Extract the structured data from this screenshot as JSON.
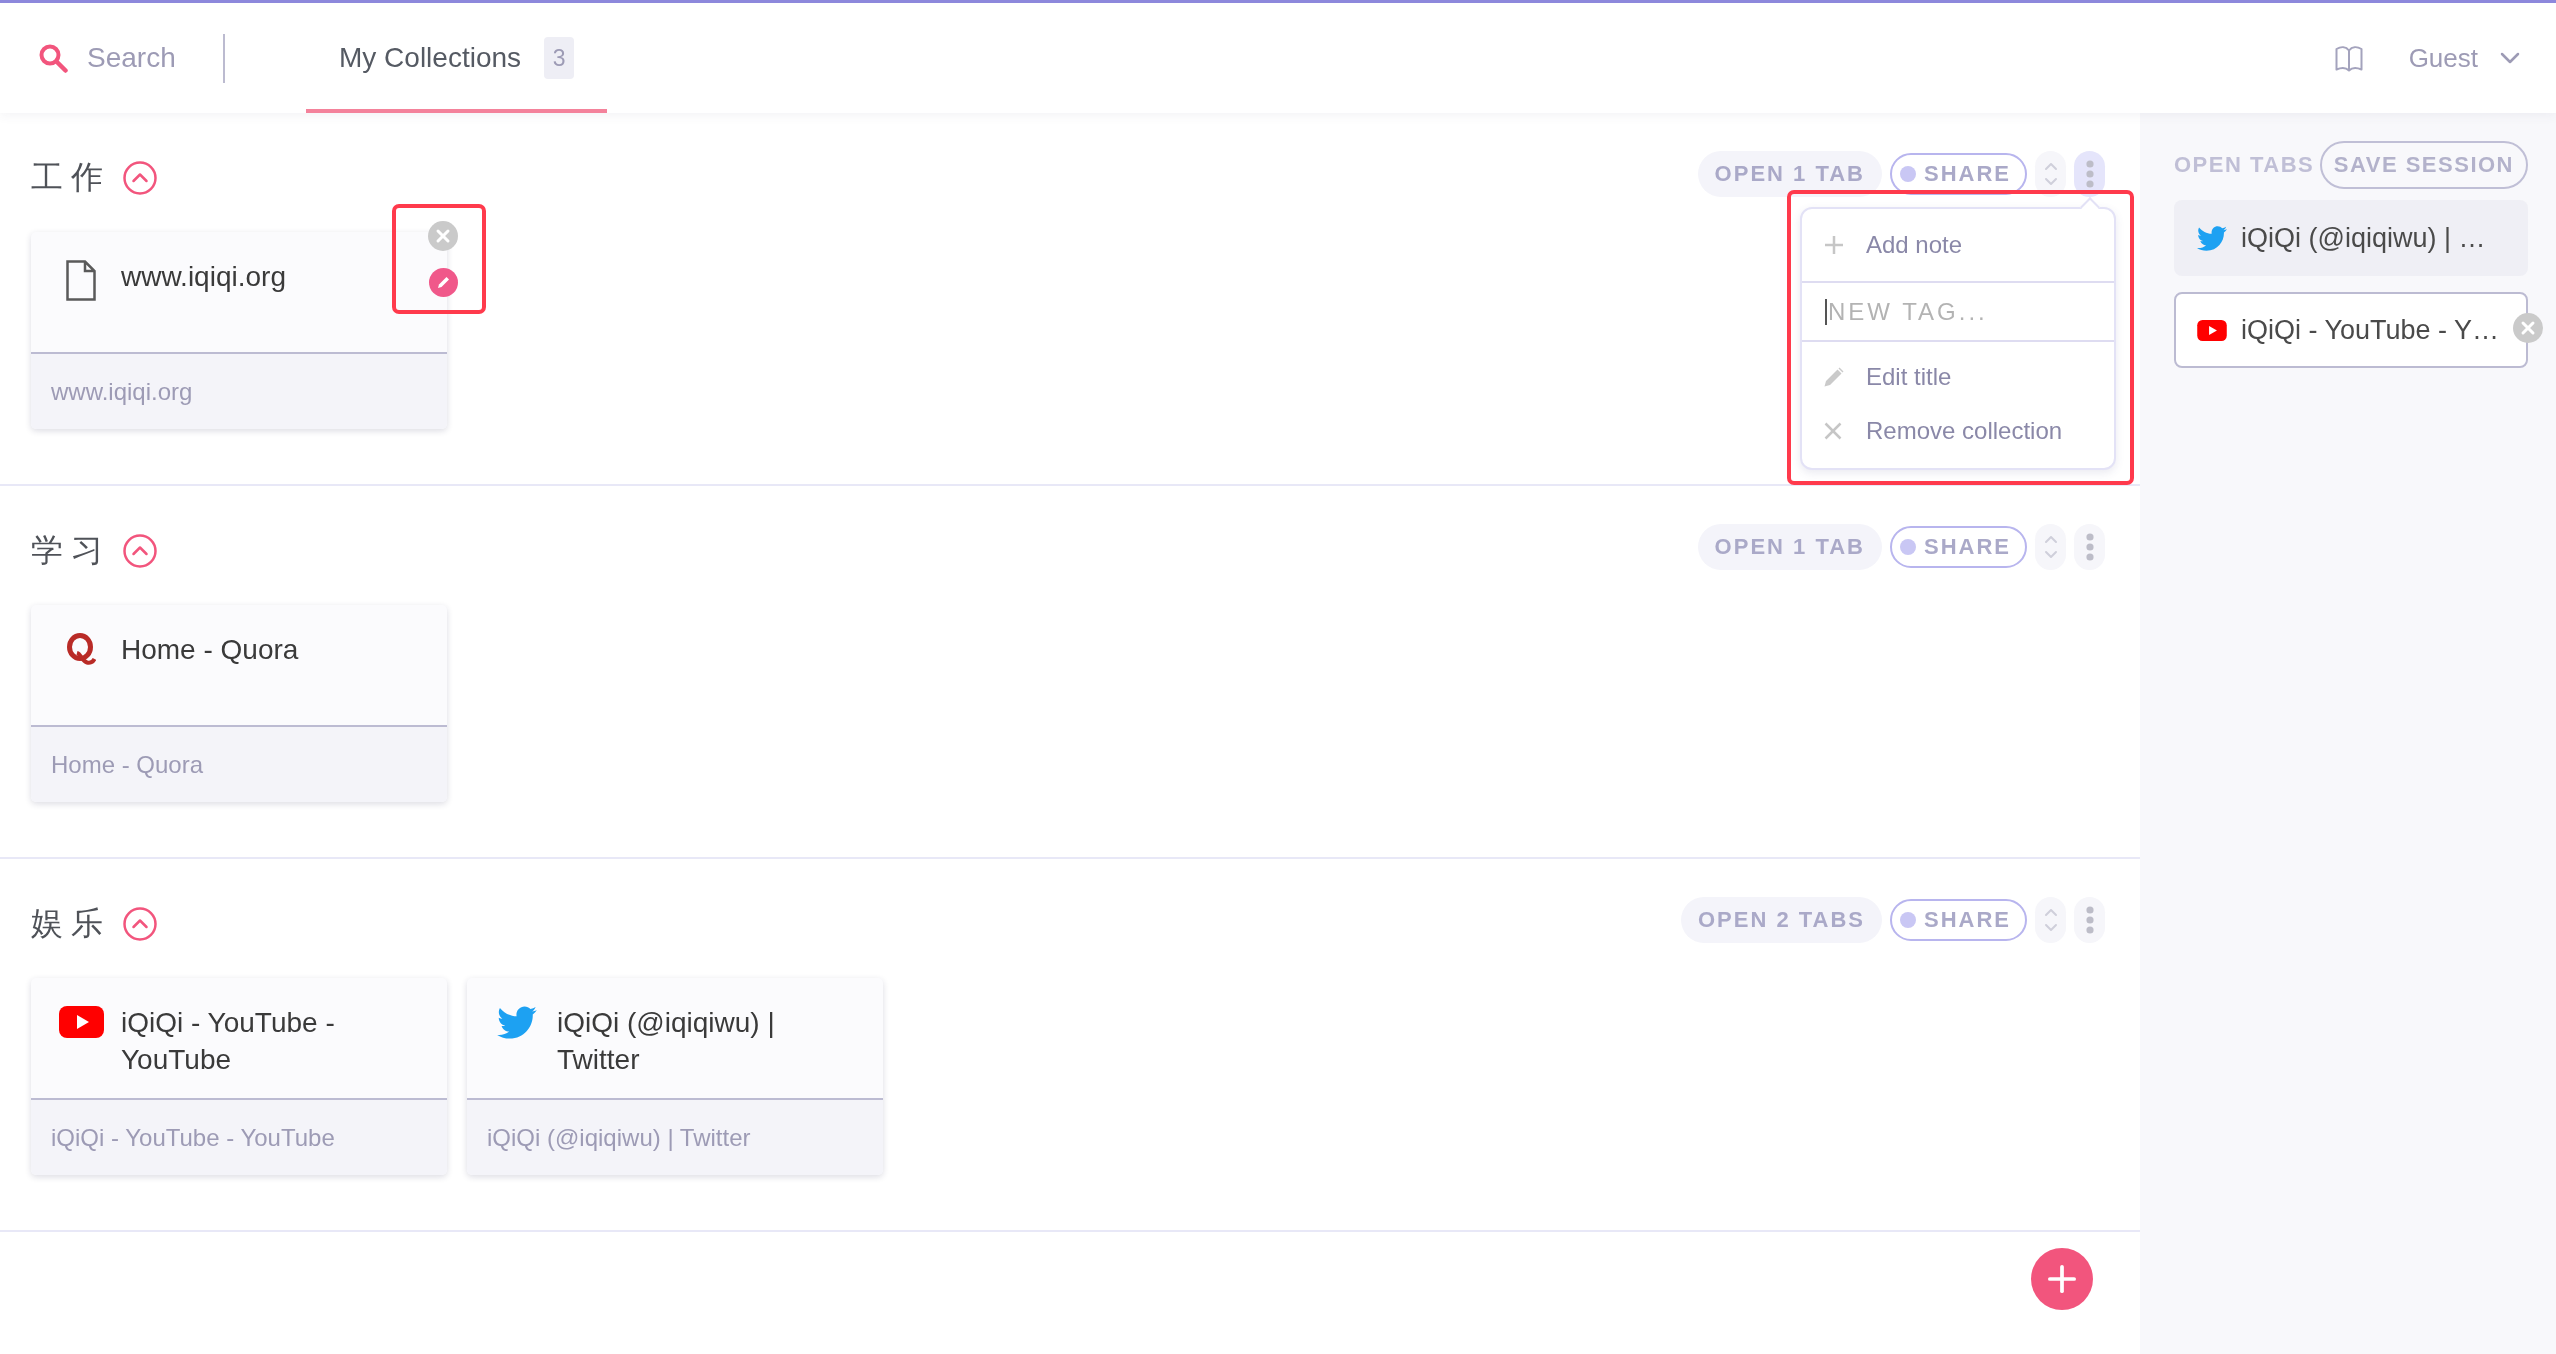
{
  "header": {
    "search": {
      "placeholder": "Search"
    },
    "tabs": [
      {
        "label": "My Collections",
        "count": "3",
        "selected": true
      }
    ],
    "user_menu": {
      "label": "Guest"
    }
  },
  "collections": [
    {
      "title": "工作",
      "expanded": true,
      "open_button": "OPEN 1 TAB",
      "share_button": "SHARE",
      "menu_open": true,
      "menu": [
        {
          "kind": "add",
          "label": "Add note"
        },
        {
          "kind": "tag-input",
          "placeholder": "NEW TAG...",
          "focused": true
        },
        {
          "kind": "edit",
          "label": "Edit title"
        },
        {
          "kind": "remove",
          "label": "Remove collection"
        }
      ],
      "tabs": [
        {
          "kind": "page",
          "title": "www.iqiqi.org",
          "subtitle": "www.iqiqi.org",
          "hovered": true
        }
      ]
    },
    {
      "title": "学习",
      "expanded": true,
      "open_button": "OPEN 1 TAB",
      "share_button": "SHARE",
      "menu_open": false,
      "tabs": [
        {
          "kind": "quora",
          "title": "Home - Quora",
          "subtitle": "Home - Quora",
          "hovered": false
        }
      ]
    },
    {
      "title": "娱乐",
      "expanded": true,
      "open_button": "OPEN 2 TABS",
      "share_button": "SHARE",
      "menu_open": false,
      "tabs": [
        {
          "kind": "youtube",
          "title": "iQiQi - YouTube - YouTube",
          "subtitle": "iQiQi - YouTube - YouTube",
          "hovered": false
        },
        {
          "kind": "twitter",
          "title": "iQiQi (@iqiqiwu) | Twitter",
          "subtitle": "iQiQi (@iqiqiwu) | Twitter",
          "hovered": false
        }
      ]
    }
  ],
  "open_tabs": {
    "heading": "OPEN TABS",
    "save_button": "SAVE SESSION",
    "tabs": [
      {
        "kind": "twitter",
        "title": "iQiQi (@iqiqiwu) | …",
        "hovered": false
      },
      {
        "kind": "youtube",
        "title": "iQiQi - YouTube - Y…",
        "hovered": true
      }
    ]
  }
}
